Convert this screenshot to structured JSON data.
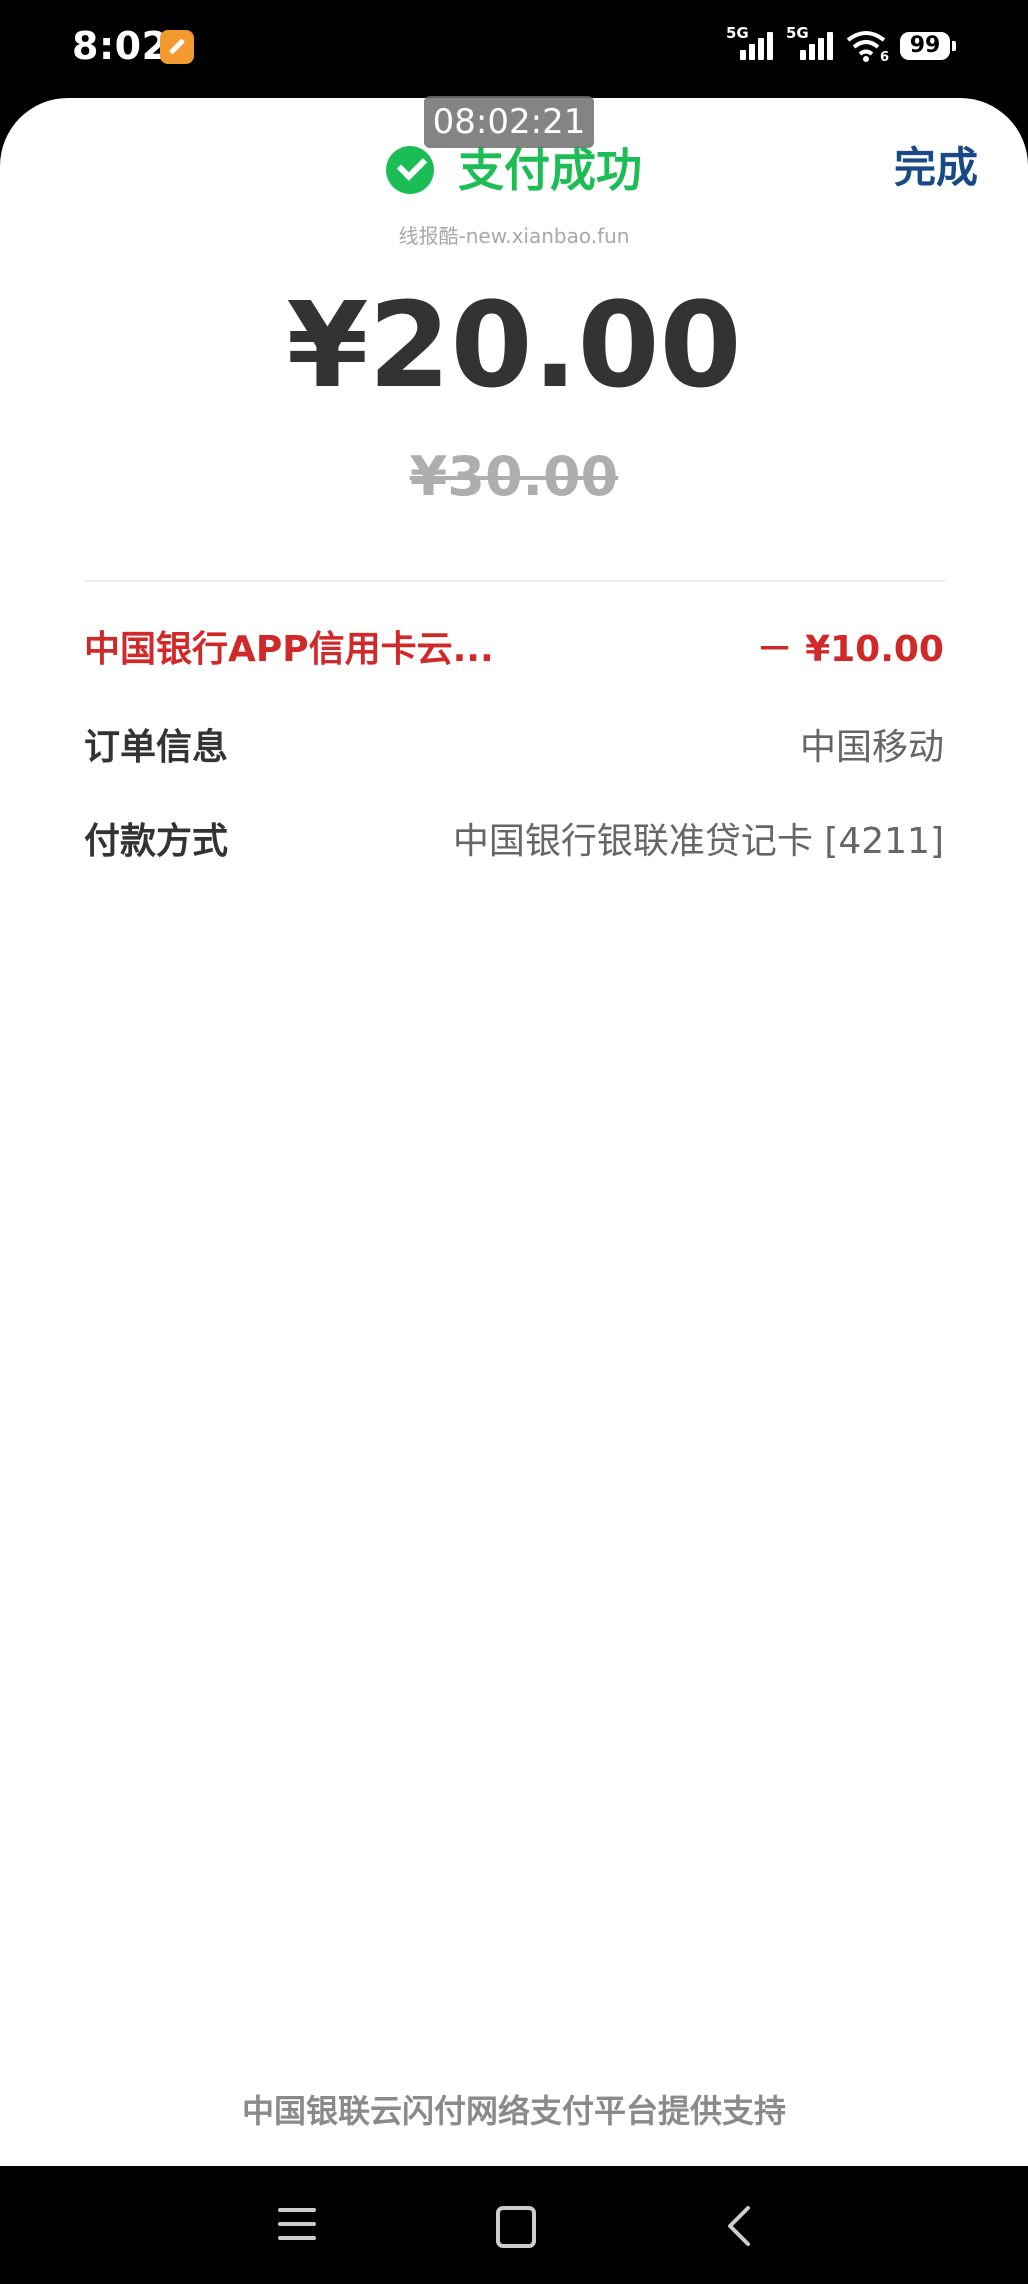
{
  "status_bar": {
    "time": "8:02",
    "network_1": "5G",
    "network_2": "5G",
    "wifi_sub": "6",
    "battery": "99"
  },
  "overlay": {
    "timestamp": "08:02:21"
  },
  "header": {
    "status_text": "支付成功",
    "done_label": "完成",
    "success_color": "#1dbd55"
  },
  "watermark": "线报酷-new.xianbao.fun",
  "payment": {
    "amount": "¥20.00",
    "original_amount": "¥30.00"
  },
  "details": {
    "discount": {
      "label": "中国银行APP信用卡云...",
      "value": "－ ¥10.00"
    },
    "order": {
      "label": "订单信息",
      "value": "中国移动"
    },
    "method": {
      "label": "付款方式",
      "value": "中国银行银联准贷记卡 [4211]"
    }
  },
  "footer": "中国银联云闪付网络支付平台提供支持",
  "nav": {
    "menu_icon": "menu-icon",
    "home_icon": "home-icon",
    "back_icon": "back-icon"
  }
}
